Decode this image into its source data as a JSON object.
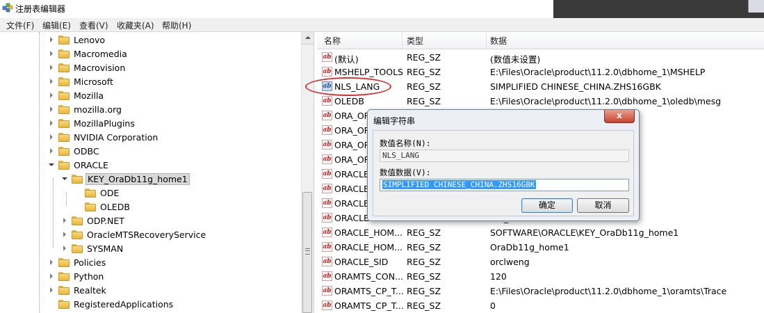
{
  "window": {
    "title": "注册表编辑器",
    "icon": "regedit-app-icon"
  },
  "menu": [
    "文件(F)",
    "编辑(E)",
    "查看(V)",
    "收藏夹(A)",
    "帮助(H)"
  ],
  "tree": {
    "items": [
      {
        "label": "Lenovo",
        "level": 0,
        "state": "collapsed"
      },
      {
        "label": "Macromedia",
        "level": 0,
        "state": "collapsed"
      },
      {
        "label": "Macrovision",
        "level": 0,
        "state": "collapsed"
      },
      {
        "label": "Microsoft",
        "level": 0,
        "state": "collapsed"
      },
      {
        "label": "Mozilla",
        "level": 0,
        "state": "collapsed"
      },
      {
        "label": "mozilla.org",
        "level": 0,
        "state": "collapsed"
      },
      {
        "label": "MozillaPlugins",
        "level": 0,
        "state": "collapsed"
      },
      {
        "label": "NVIDIA Corporation",
        "level": 0,
        "state": "collapsed"
      },
      {
        "label": "ODBC",
        "level": 0,
        "state": "collapsed"
      },
      {
        "label": "ORACLE",
        "level": 0,
        "state": "expanded"
      },
      {
        "label": "KEY_OraDb11g_home1",
        "level": 1,
        "state": "expanded",
        "selected": true
      },
      {
        "label": "ODE",
        "level": 2,
        "state": "none"
      },
      {
        "label": "OLEDB",
        "level": 2,
        "state": "none"
      },
      {
        "label": "ODP.NET",
        "level": 1,
        "state": "collapsed"
      },
      {
        "label": "OracleMTSRecoveryService",
        "level": 1,
        "state": "collapsed"
      },
      {
        "label": "SYSMAN",
        "level": 1,
        "state": "collapsed"
      },
      {
        "label": "Policies",
        "level": 0,
        "state": "collapsed"
      },
      {
        "label": "Python",
        "level": 0,
        "state": "collapsed"
      },
      {
        "label": "Realtek",
        "level": 0,
        "state": "collapsed"
      },
      {
        "label": "RegisteredApplications",
        "level": 0,
        "state": "none"
      }
    ]
  },
  "list": {
    "columns": [
      "名称",
      "类型",
      "数据"
    ],
    "rows": [
      {
        "name": "(默认)",
        "type": "REG_SZ",
        "data": "(数值未设置)"
      },
      {
        "name": "MSHELP_TOOLS",
        "type": "REG_SZ",
        "data": "E:\\Files\\Oracle\\product\\11.2.0\\dbhome_1\\MSHELP"
      },
      {
        "name": "NLS_LANG",
        "type": "REG_SZ",
        "data": "SIMPLIFIED CHINESE_CHINA.ZHS16GBK",
        "selected": true
      },
      {
        "name": "OLEDB",
        "type": "REG_SZ",
        "data": "E:\\Files\\Oracle\\product\\11.2.0\\dbhome_1\\oledb\\mesg"
      },
      {
        "name": "ORA_OR",
        "type": "",
        "data": ""
      },
      {
        "name": "ORA_OR",
        "type": "",
        "data": ""
      },
      {
        "name": "ORA_OR",
        "type": "",
        "data": ""
      },
      {
        "name": "ORA_OR",
        "type": "",
        "data": ""
      },
      {
        "name": "ORACLE",
        "type": "",
        "data": ""
      },
      {
        "name": "ORACLE",
        "type": "",
        "data": ""
      },
      {
        "name": "ORACLE",
        "type": "",
        "data": ""
      },
      {
        "name": "ORACLE",
        "type": "",
        "data": "me_1"
      },
      {
        "name": "ORACLE_HOM...",
        "type": "REG_SZ",
        "data": "SOFTWARE\\ORACLE\\KEY_OraDb11g_home1"
      },
      {
        "name": "ORACLE_HOM...",
        "type": "REG_SZ",
        "data": "OraDb11g_home1"
      },
      {
        "name": "ORACLE_SID",
        "type": "REG_SZ",
        "data": "orclweng"
      },
      {
        "name": "ORAMTS_CON...",
        "type": "REG_SZ",
        "data": "120"
      },
      {
        "name": "ORAMTS_CP_T...",
        "type": "REG_SZ",
        "data": "E:\\Files\\Oracle\\product\\11.2.0\\dbhome_1\\oramts\\Trace"
      },
      {
        "name": "ORAMTS_CP_T...",
        "type": "REG_SZ",
        "data": "0"
      }
    ]
  },
  "dialog": {
    "title": "编辑字符串",
    "close_label": "x",
    "name_label": "数值名称(N):",
    "name_value": "NLS_LANG",
    "data_label": "数值数据(V):",
    "data_value": "SIMPLIFIED CHINESE_CHINA.ZHS16GBK",
    "ok_label": "确定",
    "cancel_label": "取消"
  },
  "annotation": {
    "color": "#e03030"
  }
}
